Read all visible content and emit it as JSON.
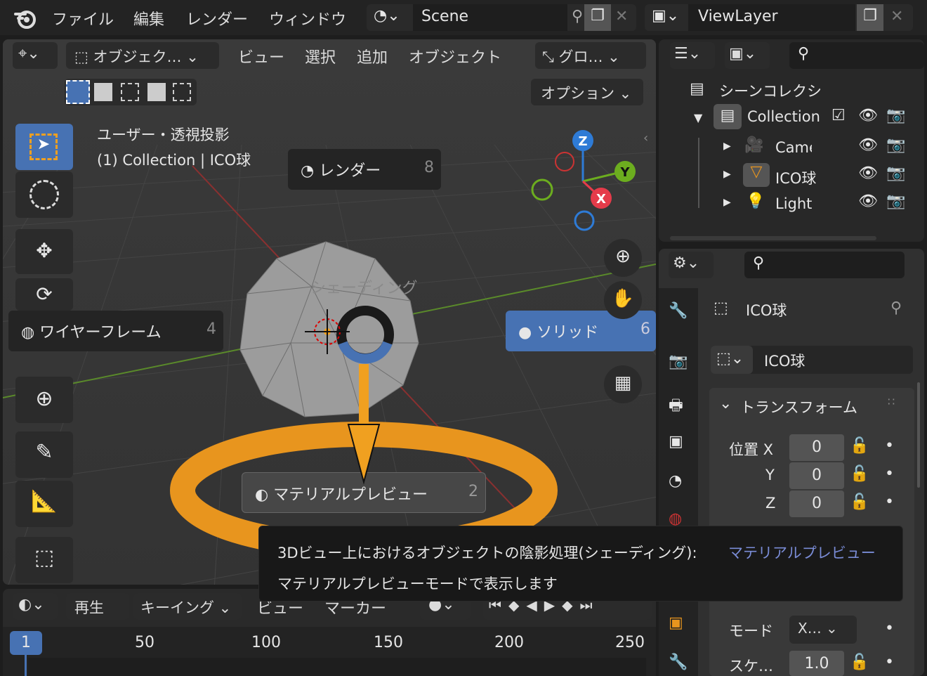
{
  "topbar": {
    "menus": [
      "ファイル",
      "編集",
      "レンダー",
      "ウィンドウ"
    ],
    "scene": "Scene",
    "viewlayer": "ViewLayer"
  },
  "viewport_header": {
    "mode": "オブジェク…",
    "menus": [
      "ビュー",
      "選択",
      "追加",
      "オブジェクト"
    ],
    "orientation": "グロ…",
    "options": "オプション"
  },
  "viewport": {
    "view_name": "ユーザー・透視投影",
    "collection_line": "(1) Collection | ICO球"
  },
  "pie_menu": {
    "title": "シェーディング",
    "items": [
      {
        "label": "レンダー",
        "key": "8"
      },
      {
        "label": "ワイヤーフレーム",
        "key": "4"
      },
      {
        "label": "ソリッド",
        "key": "6"
      },
      {
        "label": "マテリアルプレビュー",
        "key": "2"
      }
    ]
  },
  "gizmo": {
    "z": "Z",
    "y": "Y",
    "x": "X"
  },
  "outliner": {
    "root": "シーンコレクシ",
    "collection": "Collection",
    "items": [
      "Camera",
      "ICO球",
      "Light"
    ]
  },
  "properties": {
    "object_name": "ICO球",
    "data_name": "ICO球",
    "panel": "トランスフォーム",
    "location_label": "位置 X",
    "axes": [
      "Y",
      "Z"
    ],
    "location": [
      "0",
      "0",
      "0"
    ],
    "mode_label": "モード",
    "mode_value": "X…",
    "scale_label": "スケ…",
    "scale_value": "1.0"
  },
  "tooltip": {
    "line1": "3Dビュー上におけるオブジェクトの陰影処理(シェーディング):",
    "value": "マテリアルプレビュー",
    "line2": "マテリアルプレビューモードで表示します"
  },
  "timeline": {
    "playback": "再生",
    "keying": "キーイング",
    "view": "ビュー",
    "marker": "マーカー",
    "current_frame": "1",
    "ticks": [
      "50",
      "100",
      "150",
      "200",
      "250"
    ]
  },
  "colors": {
    "accent": "#4772b3",
    "highlight": "#e8951e",
    "tooltip_value": "#7a8cd6"
  }
}
